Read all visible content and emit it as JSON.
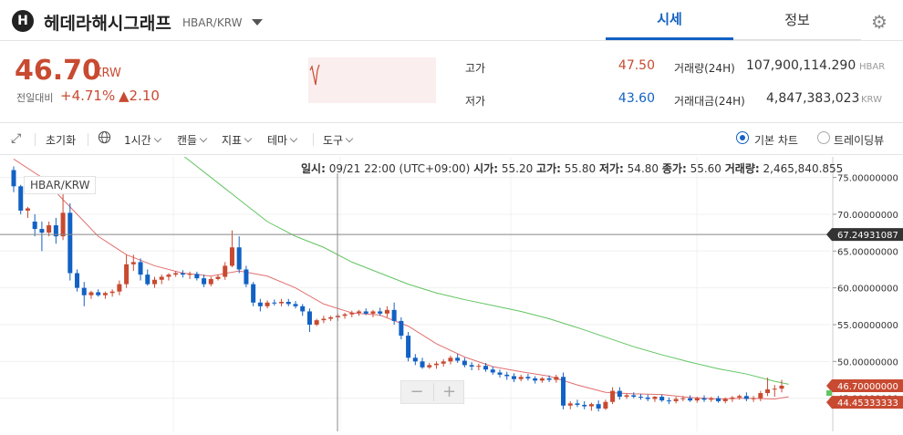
{
  "header": {
    "logo_letter": "H",
    "coin_name": "헤데라해시그래프",
    "pair": "HBAR/KRW",
    "tabs": [
      {
        "label": "시세",
        "active": true
      },
      {
        "label": "정보",
        "active": false
      }
    ],
    "settings_icon": "gear-icon"
  },
  "price": {
    "current": "46.70",
    "unit": "KRW",
    "change_label": "전일대비",
    "change_pct": "+4.71%",
    "change_amt": "▲2.10",
    "color_up": "#c84a31",
    "color_down": "#1261c4"
  },
  "stats": {
    "high_label": "고가",
    "high_value": "47.50",
    "low_label": "저가",
    "low_value": "43.60",
    "volume_label": "거래량(24H)",
    "volume_value": "107,900,114.290",
    "volume_unit": "HBAR",
    "amount_label": "거래대금(24H)",
    "amount_value": "4,847,383,023",
    "amount_unit": "KRW"
  },
  "toolbar": {
    "expand_icon": "expand-icon",
    "reset": "초기화",
    "globe_icon": "globe-icon",
    "interval": "1시간",
    "candle": "캔들",
    "indicator": "지표",
    "theme": "테마",
    "tools": "도구",
    "basic_chart": "기본 차트",
    "tradingview": "트레이딩뷰",
    "selected_mode": "기본 차트"
  },
  "chart": {
    "pair_label": "HBAR/KRW",
    "info": {
      "time_label": "일시:",
      "time_value": "09/21 22:00 (UTC+09:00)",
      "open_label": "시가:",
      "open_value": "55.20",
      "high_label": "고가:",
      "high_value": "55.80",
      "low_label": "저가:",
      "low_value": "54.80",
      "close_label": "종가:",
      "close_value": "55.60",
      "vol_label": "거래량:",
      "vol_value": "2,465,840.855"
    },
    "zoom_minus": "−",
    "zoom_plus": "+",
    "crosshair_value": "67.24931087",
    "last_price_tag": "46.70000000",
    "ma_tag": "44.45333333"
  },
  "chart_data": {
    "type": "candlestick",
    "y_ticks": [
      "75.00000000",
      "70.00000000",
      "65.00000000",
      "60.00000000",
      "55.00000000",
      "50.00000000",
      "45.00000000"
    ],
    "ylim": [
      40.5,
      77.8
    ],
    "crosshair_y": 67.25,
    "ohlc": [
      [
        76,
        76.5,
        73,
        73.8
      ],
      [
        73.8,
        74,
        70,
        70.5
      ],
      [
        70.5,
        71,
        69.5,
        70.8
      ],
      [
        69,
        70,
        67,
        68
      ],
      [
        68,
        69,
        65,
        67.5
      ],
      [
        67.5,
        69,
        67,
        68.5
      ],
      [
        68.5,
        69.5,
        66,
        67
      ],
      [
        67,
        73,
        66.5,
        70.2
      ],
      [
        70.2,
        71.5,
        61,
        62
      ],
      [
        62,
        62.5,
        59.5,
        60
      ],
      [
        60,
        60.8,
        57.5,
        59
      ],
      [
        59,
        59.6,
        58.5,
        59.4
      ],
      [
        59.4,
        59.8,
        58.8,
        59
      ],
      [
        59,
        59.5,
        58.5,
        59.3
      ],
      [
        59.3,
        59.8,
        58.8,
        59.5
      ],
      [
        59.5,
        61,
        59,
        60.5
      ],
      [
        60.5,
        64.5,
        60,
        63.2
      ],
      [
        63.2,
        64.5,
        62.3,
        63.5
      ],
      [
        63.5,
        64,
        61,
        61.8
      ],
      [
        61.8,
        62.5,
        60.3,
        60.5
      ],
      [
        60.5,
        61.5,
        60,
        61.1
      ],
      [
        61.1,
        61.8,
        60.5,
        61.5
      ],
      [
        61.5,
        62,
        61,
        61.8
      ],
      [
        61.8,
        62.3,
        61.5,
        62
      ],
      [
        62,
        62.4,
        61.4,
        61.8
      ],
      [
        61.8,
        62.2,
        61.2,
        61.9
      ],
      [
        61.9,
        62.2,
        61,
        61.3
      ],
      [
        61.3,
        61.8,
        60.1,
        60.5
      ],
      [
        60.5,
        61.5,
        60.2,
        61.2
      ],
      [
        61.2,
        61.8,
        61,
        61.5
      ],
      [
        61.5,
        63.5,
        61.1,
        63
      ],
      [
        63,
        67.8,
        62.8,
        65.5
      ],
      [
        65.5,
        67,
        62,
        62.5
      ],
      [
        62.5,
        63,
        60.1,
        60.5
      ],
      [
        60.5,
        60.8,
        57.5,
        58
      ],
      [
        58,
        58.5,
        56.8,
        57.5
      ],
      [
        57.5,
        58.3,
        57.2,
        58
      ],
      [
        58,
        58.4,
        57.6,
        57.9
      ],
      [
        57.9,
        58.5,
        57.5,
        58.1
      ],
      [
        58.1,
        58.5,
        57.5,
        57.8
      ],
      [
        57.8,
        58.2,
        57.2,
        57.5
      ],
      [
        57.5,
        57.8,
        56.2,
        56.8
      ],
      [
        56.8,
        57.2,
        54,
        55
      ],
      [
        55,
        55.8,
        54.8,
        55.6
      ],
      [
        55.6,
        56.2,
        55.2,
        55.8
      ],
      [
        55.8,
        56.2,
        55.5,
        56
      ],
      [
        56,
        56.5,
        55.5,
        56.2
      ],
      [
        56.2,
        56.6,
        55.8,
        56.4
      ],
      [
        56.4,
        56.9,
        56,
        56.6
      ],
      [
        56.6,
        57,
        56.2,
        56.8
      ],
      [
        56.8,
        57.2,
        56.3,
        56.5
      ],
      [
        56.5,
        57,
        56,
        56.8
      ],
      [
        56.8,
        57.3,
        56.2,
        56.5
      ],
      [
        56.5,
        57.5,
        56,
        57
      ],
      [
        57,
        58,
        55,
        55.5
      ],
      [
        55.5,
        56,
        53,
        53.5
      ],
      [
        53.5,
        54,
        50,
        50.5
      ],
      [
        50.5,
        51,
        49.5,
        50
      ],
      [
        50,
        50.5,
        49,
        49.2
      ],
      [
        49.2,
        49.8,
        49,
        49.5
      ],
      [
        49.5,
        50,
        49,
        49.7
      ],
      [
        49.7,
        50.3,
        49.3,
        50
      ],
      [
        50,
        50.8,
        49.6,
        50.5
      ],
      [
        50.5,
        51,
        49.8,
        50.1
      ],
      [
        50.1,
        50.5,
        49.2,
        49.5
      ],
      [
        49.5,
        49.9,
        48.8,
        49.3
      ],
      [
        49.3,
        49.7,
        48.8,
        49.4
      ],
      [
        49.4,
        49.8,
        48.6,
        48.9
      ],
      [
        48.9,
        49.3,
        48.2,
        48.5
      ],
      [
        48.5,
        48.9,
        47.8,
        48.2
      ],
      [
        48.2,
        48.6,
        47.5,
        48
      ],
      [
        48,
        48.4,
        47.2,
        47.6
      ],
      [
        47.6,
        48.2,
        47.3,
        47.9
      ],
      [
        47.9,
        48.3,
        47.4,
        47.7
      ],
      [
        47.7,
        48,
        47,
        47.4
      ],
      [
        47.4,
        47.9,
        47.1,
        47.7
      ],
      [
        47.7,
        48.1,
        47.2,
        47.5
      ],
      [
        47.5,
        48.2,
        47.1,
        47.9
      ],
      [
        47.9,
        48.5,
        43.5,
        44
      ],
      [
        44,
        44.6,
        43.5,
        44.3
      ],
      [
        44.3,
        44.8,
        43.8,
        44.1
      ],
      [
        44.1,
        44.6,
        43.5,
        43.9
      ],
      [
        43.9,
        44.4,
        43.3,
        44.2
      ],
      [
        44.2,
        44.7,
        43.2,
        43.6
      ],
      [
        43.6,
        44.8,
        43.4,
        44.5
      ],
      [
        44.5,
        46.5,
        44.2,
        46
      ],
      [
        46,
        46.5,
        44.8,
        45.2
      ],
      [
        45.2,
        45.6,
        44.9,
        45.4
      ],
      [
        45.4,
        45.8,
        45,
        45.2
      ],
      [
        45.2,
        45.6,
        44.8,
        45.1
      ],
      [
        45.1,
        45.5,
        44.6,
        44.9
      ],
      [
        44.9,
        45.3,
        44.5,
        45.2
      ],
      [
        45.2,
        45.5,
        44.5,
        44.7
      ],
      [
        44.7,
        45.1,
        44.2,
        44.6
      ],
      [
        44.6,
        45.2,
        44.3,
        44.9
      ],
      [
        44.9,
        45.3,
        44.6,
        45
      ],
      [
        45,
        45.4,
        44.5,
        44.7
      ],
      [
        44.7,
        45.2,
        44.4,
        45
      ],
      [
        45,
        45.4,
        44.5,
        44.8
      ],
      [
        44.8,
        45.2,
        44.5,
        45
      ],
      [
        45,
        45.3,
        44.4,
        44.6
      ],
      [
        44.6,
        45.1,
        44.3,
        44.9
      ],
      [
        44.9,
        45.3,
        44.5,
        45.1
      ],
      [
        45.1,
        45.5,
        44.8,
        45.3
      ],
      [
        45.3,
        45.8,
        44.6,
        44.9
      ],
      [
        44.9,
        45.3,
        44.5,
        45
      ],
      [
        45,
        46,
        44.6,
        45.7
      ],
      [
        45.7,
        47.8,
        45.3,
        46.2
      ],
      [
        46.2,
        46.8,
        45.2,
        46.3
      ],
      [
        46.3,
        47.5,
        45.8,
        46.7
      ]
    ],
    "series": [
      {
        "color": "#e36f6f",
        "values": [
          [
            0,
            77.5
          ],
          [
            4,
            75
          ],
          [
            8,
            71
          ],
          [
            12,
            67
          ],
          [
            16,
            64.5
          ],
          [
            20,
            63
          ],
          [
            24,
            62
          ],
          [
            28,
            61.6
          ],
          [
            32,
            62.3
          ],
          [
            36,
            61.6
          ],
          [
            40,
            60
          ],
          [
            44,
            57.8
          ],
          [
            48,
            56.6
          ],
          [
            52,
            56.3
          ],
          [
            56,
            54.8
          ],
          [
            60,
            52.4
          ],
          [
            64,
            50.6
          ],
          [
            68,
            49.3
          ],
          [
            72,
            48.6
          ],
          [
            76,
            48
          ],
          [
            80,
            46.8
          ],
          [
            84,
            45.8
          ],
          [
            88,
            45.6
          ],
          [
            92,
            45.5
          ],
          [
            96,
            45.1
          ],
          [
            100,
            44.9
          ],
          [
            104,
            45
          ],
          [
            108,
            44.9
          ],
          [
            110,
            45.2
          ]
        ]
      },
      {
        "color": "#62c462",
        "values": [
          [
            24,
            78
          ],
          [
            30,
            73.5
          ],
          [
            36,
            69
          ],
          [
            40,
            67
          ],
          [
            44,
            65.5
          ],
          [
            48,
            63.5
          ],
          [
            52,
            62
          ],
          [
            56,
            60.5
          ],
          [
            60,
            59.3
          ],
          [
            64,
            58.4
          ],
          [
            68,
            57.6
          ],
          [
            72,
            56.8
          ],
          [
            76,
            55.8
          ],
          [
            80,
            54.6
          ],
          [
            84,
            53.3
          ],
          [
            88,
            52
          ],
          [
            92,
            50.9
          ],
          [
            96,
            49.9
          ],
          [
            100,
            49
          ],
          [
            104,
            48.3
          ],
          [
            108,
            47.3
          ],
          [
            110,
            46.9
          ]
        ]
      }
    ]
  }
}
